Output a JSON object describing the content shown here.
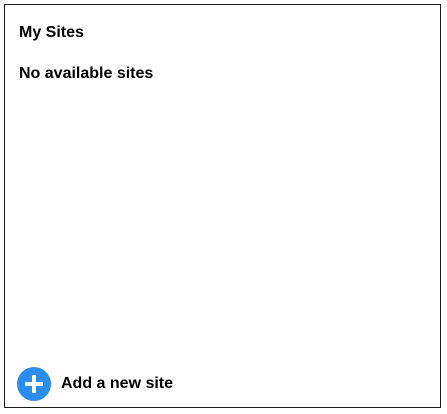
{
  "panel": {
    "title": "My Sites",
    "empty_message": "No available sites"
  },
  "add_site": {
    "label": "Add a new site",
    "icon": "plus-circle-icon",
    "icon_color": "#2b8cf0"
  }
}
